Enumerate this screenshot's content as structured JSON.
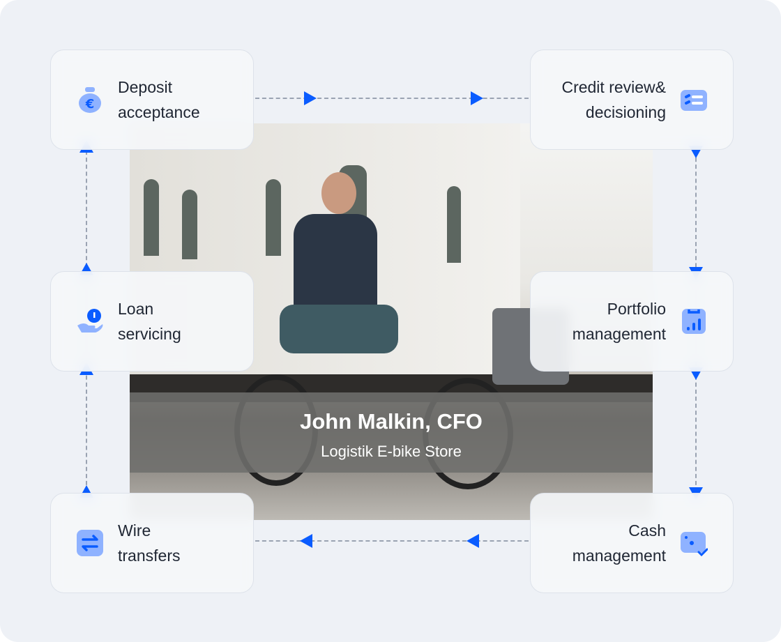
{
  "accent": "#0a5cff",
  "cards": {
    "deposit": {
      "line1": "Deposit",
      "line2": "acceptance",
      "icon": "money-bag-euro-icon"
    },
    "credit": {
      "line1": "Credit review&",
      "line2": "decisioning",
      "icon": "checklist-icon"
    },
    "loan": {
      "line1": "Loan",
      "line2": "servicing",
      "icon": "hand-coin-icon"
    },
    "portfolio": {
      "line1": "Portfolio",
      "line2": "management",
      "icon": "clipboard-chart-icon"
    },
    "wire": {
      "line1": "Wire",
      "line2": "transfers",
      "icon": "transfer-arrows-icon"
    },
    "cash": {
      "line1": "Cash",
      "line2": "management",
      "icon": "card-check-icon"
    }
  },
  "testimonial": {
    "name": "John Malkin, CFO",
    "company": "Logistik E-bike Store"
  }
}
